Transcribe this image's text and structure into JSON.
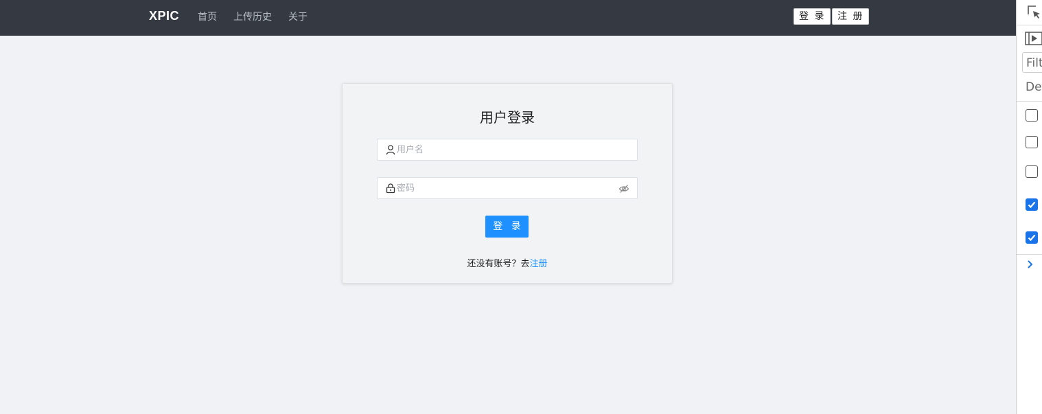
{
  "header": {
    "brand": "XPIC",
    "nav": [
      {
        "label": "首页"
      },
      {
        "label": "上传历史"
      },
      {
        "label": "关于"
      }
    ],
    "login_label": "登 录",
    "register_label": "注 册"
  },
  "login_card": {
    "title": "用户登录",
    "username_placeholder": "用户名",
    "password_placeholder": "密码",
    "submit_label": "登 录",
    "hint_text": "还没有账号？去",
    "hint_link": "注册",
    "icons": {
      "username": "user-icon",
      "password": "lock-icon",
      "toggle": "eye-off-icon"
    }
  },
  "devtools": {
    "filter_text": "Filt",
    "default_text": "Def",
    "checkboxes": [
      false,
      false,
      false,
      true,
      true
    ]
  },
  "colors": {
    "header_bg": "#353a42",
    "primary": "#1e90ff",
    "page_bg": "#f0f2f5"
  }
}
